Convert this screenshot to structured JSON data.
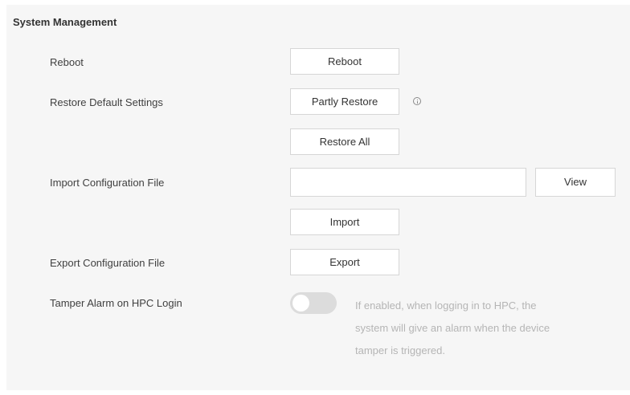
{
  "section": {
    "title": "System Management"
  },
  "reboot": {
    "label": "Reboot",
    "button_label": "Reboot"
  },
  "restore": {
    "label": "Restore Default Settings",
    "partly_button_label": "Partly Restore",
    "all_button_label": "Restore All",
    "info_icon": "info-circle-icon"
  },
  "import_config": {
    "label": "Import Configuration File",
    "file_value": "",
    "view_button_label": "View",
    "import_button_label": "Import"
  },
  "export_config": {
    "label": "Export Configuration File",
    "button_label": "Export"
  },
  "tamper_alarm": {
    "label": "Tamper Alarm on HPC Login",
    "enabled": false,
    "hint_line1": "If enabled, when logging in to HPC, the",
    "hint_line2": "system will give an alarm when the device",
    "hint_line3": "tamper is triggered."
  },
  "colors": {
    "panel_background": "#f6f6f6",
    "button_border": "#d6d6d6",
    "toggle_off": "#dcdcdc",
    "hint_text": "#b5b5b5"
  }
}
